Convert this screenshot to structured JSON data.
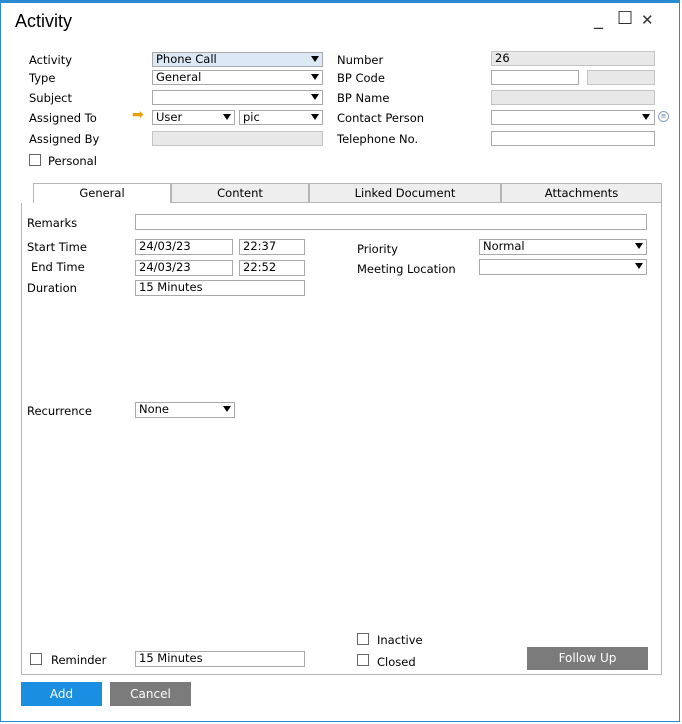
{
  "window": {
    "title": "Activity",
    "minimize": "_",
    "maximize": "☐",
    "close": "✕"
  },
  "header": {
    "activity_label": "Activity",
    "activity_value": "Phone Call",
    "type_label": "Type",
    "type_value": "General",
    "subject_label": "Subject",
    "subject_value": "",
    "assigned_to_label": "Assigned To",
    "assigned_to_type": "User",
    "assigned_to_value": "pic",
    "assigned_by_label": "Assigned By",
    "assigned_by_value": "",
    "personal_label": "Personal",
    "number_label": "Number",
    "number_value": "26",
    "bp_code_label": "BP Code",
    "bp_code_value": "",
    "bp_code_value2": "",
    "bp_name_label": "BP Name",
    "bp_name_value": "",
    "contact_person_label": "Contact Person",
    "contact_person_value": "",
    "telephone_label": "Telephone No.",
    "telephone_value": ""
  },
  "tabs": [
    "General",
    "Content",
    "Linked Document",
    "Attachments"
  ],
  "general": {
    "remarks_label": "Remarks",
    "remarks_value": "",
    "start_time_label": "Start Time",
    "start_date": "24/03/23",
    "start_time": "22:37",
    "end_time_label": "End Time",
    "end_date": "24/03/23",
    "end_time": "22:52",
    "duration_label": "Duration",
    "duration_value": "15 Minutes",
    "priority_label": "Priority",
    "priority_value": "Normal",
    "meeting_location_label": "Meeting Location",
    "meeting_location_value": "",
    "recurrence_label": "Recurrence",
    "recurrence_value": "None",
    "reminder_label": "Reminder",
    "reminder_value": "15 Minutes",
    "inactive_label": "Inactive",
    "closed_label": "Closed",
    "follow_up_label": "Follow Up"
  },
  "footer": {
    "add_label": "Add",
    "cancel_label": "Cancel"
  },
  "colors": {
    "accent": "#2a8ad4",
    "add_button": "#1a8ee0",
    "cancel_button": "#7b7b7b",
    "follow_up_button": "#7b7b7b",
    "arrow": "#e8a000"
  }
}
